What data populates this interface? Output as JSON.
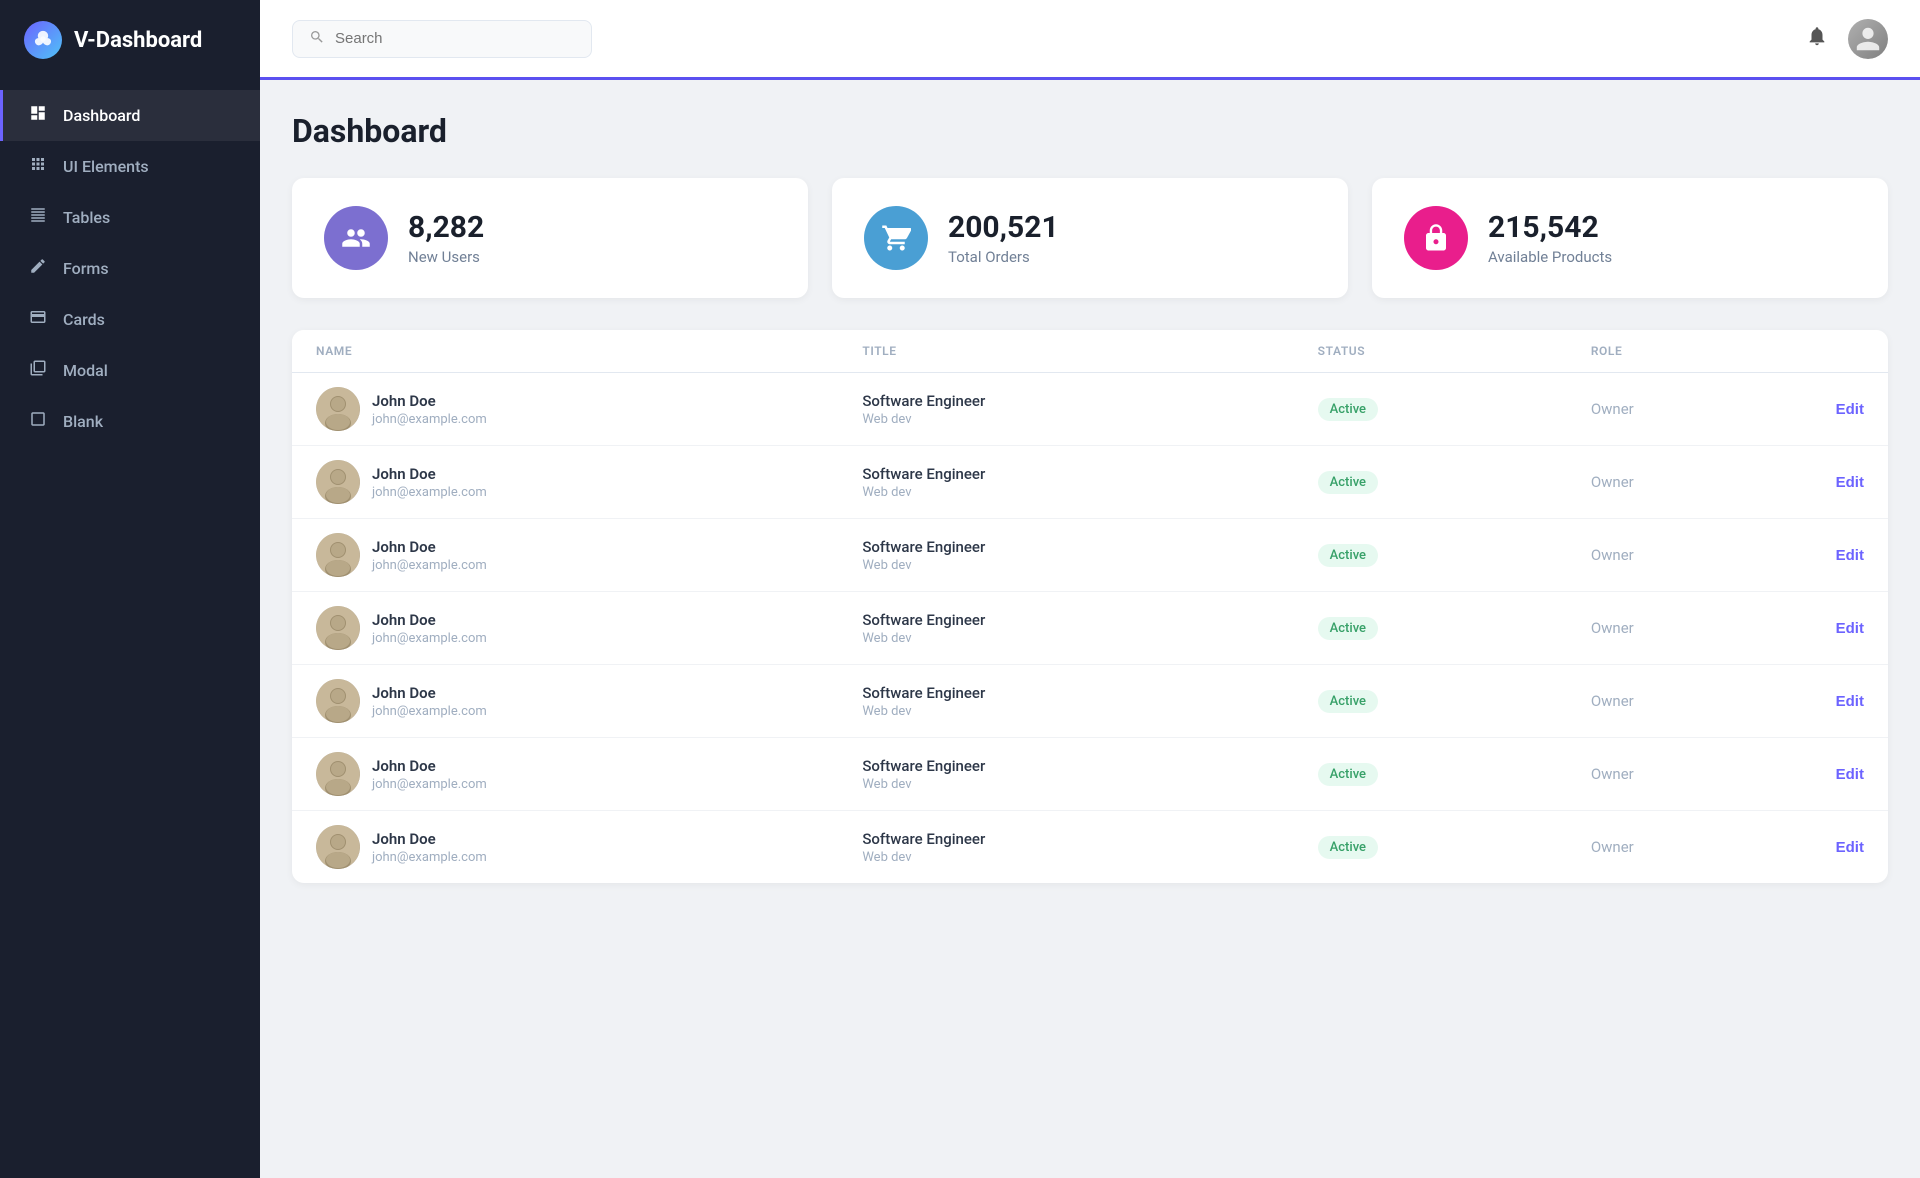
{
  "sidebar": {
    "logo_icon": "🔥",
    "logo_text": "V-Dashboard",
    "items": [
      {
        "id": "dashboard",
        "label": "Dashboard",
        "icon": "◑",
        "active": true
      },
      {
        "id": "ui-elements",
        "label": "UI Elements",
        "icon": "⊞",
        "active": false
      },
      {
        "id": "tables",
        "label": "Tables",
        "icon": "≡",
        "active": false
      },
      {
        "id": "forms",
        "label": "Forms",
        "icon": "✎",
        "active": false
      },
      {
        "id": "cards",
        "label": "Cards",
        "icon": "▬",
        "active": false
      },
      {
        "id": "modal",
        "label": "Modal",
        "icon": "◫",
        "active": false
      },
      {
        "id": "blank",
        "label": "Blank",
        "icon": "▭",
        "active": false
      }
    ]
  },
  "topbar": {
    "search_placeholder": "Search",
    "bell_icon": "🔔",
    "user_icon": "👤"
  },
  "page": {
    "title": "Dashboard"
  },
  "stats": [
    {
      "id": "new-users",
      "value": "8,282",
      "label": "New Users",
      "icon": "👥",
      "color": "purple"
    },
    {
      "id": "total-orders",
      "value": "200,521",
      "label": "Total Orders",
      "icon": "🛒",
      "color": "blue"
    },
    {
      "id": "available-products",
      "value": "215,542",
      "label": "Available Products",
      "icon": "🔒",
      "color": "pink"
    }
  ],
  "table": {
    "headers": [
      "NAME",
      "TITLE",
      "STATUS",
      "ROLE"
    ],
    "rows": [
      {
        "name": "John Doe",
        "email": "john@example.com",
        "title": "Software Engineer",
        "subtitle": "Web dev",
        "status": "Active",
        "role": "Owner"
      },
      {
        "name": "John Doe",
        "email": "john@example.com",
        "title": "Software Engineer",
        "subtitle": "Web dev",
        "status": "Active",
        "role": "Owner"
      },
      {
        "name": "John Doe",
        "email": "john@example.com",
        "title": "Software Engineer",
        "subtitle": "Web dev",
        "status": "Active",
        "role": "Owner"
      },
      {
        "name": "John Doe",
        "email": "john@example.com",
        "title": "Software Engineer",
        "subtitle": "Web dev",
        "status": "Active",
        "role": "Owner"
      },
      {
        "name": "John Doe",
        "email": "john@example.com",
        "title": "Software Engineer",
        "subtitle": "Web dev",
        "status": "Active",
        "role": "Owner"
      },
      {
        "name": "John Doe",
        "email": "john@example.com",
        "title": "Software Engineer",
        "subtitle": "Web dev",
        "status": "Active",
        "role": "Owner"
      },
      {
        "name": "John Doe",
        "email": "john@example.com",
        "title": "Software Engineer",
        "subtitle": "Web dev",
        "status": "Active",
        "role": "Owner"
      }
    ],
    "edit_label": "Edit"
  }
}
